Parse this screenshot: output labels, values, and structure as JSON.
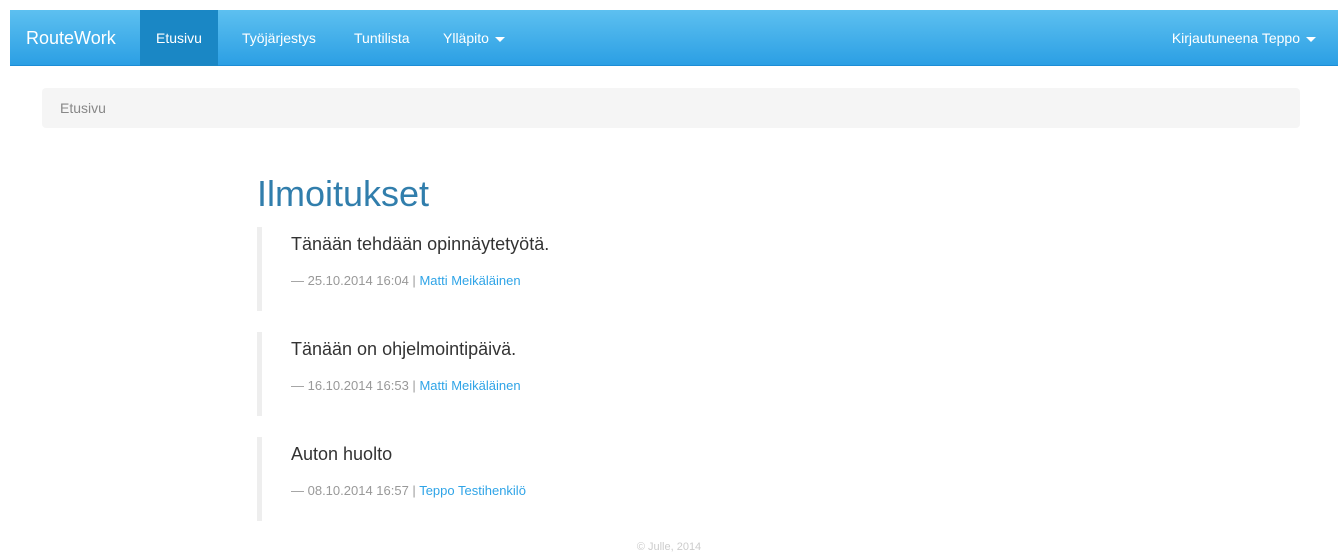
{
  "navbar": {
    "brand": "RouteWork",
    "items": [
      {
        "label": "Etusivu",
        "active": true
      },
      {
        "label": "Työjärjestys",
        "active": false
      },
      {
        "label": "Tuntilista",
        "active": false
      },
      {
        "label": "Ylläpito",
        "active": false,
        "dropdown": true
      }
    ],
    "user_menu": {
      "label": "Kirjautuneena Teppo",
      "dropdown": true
    },
    "colors": {
      "gradient_top": "#5dc0f0",
      "gradient_bottom": "#2b9fe4",
      "active_bg": "#1a87c5"
    }
  },
  "breadcrumb": {
    "label": "Etusivu"
  },
  "main": {
    "title": "Ilmoitukset",
    "notices": [
      {
        "text": "Tänään tehdään opinnäytetyötä.",
        "meta_prefix": "— 25.10.2014 16:04 |",
        "author": "Matti Meikäläinen"
      },
      {
        "text": "Tänään on ohjelmointipäivä.",
        "meta_prefix": "— 16.10.2014 16:53 |",
        "author": "Matti Meikäläinen"
      },
      {
        "text": "Auton huolto",
        "meta_prefix": "— 08.10.2014 16:57 |",
        "author": "Teppo Testihenkilö"
      }
    ]
  },
  "footer": {
    "text": "© Julle, 2014"
  }
}
